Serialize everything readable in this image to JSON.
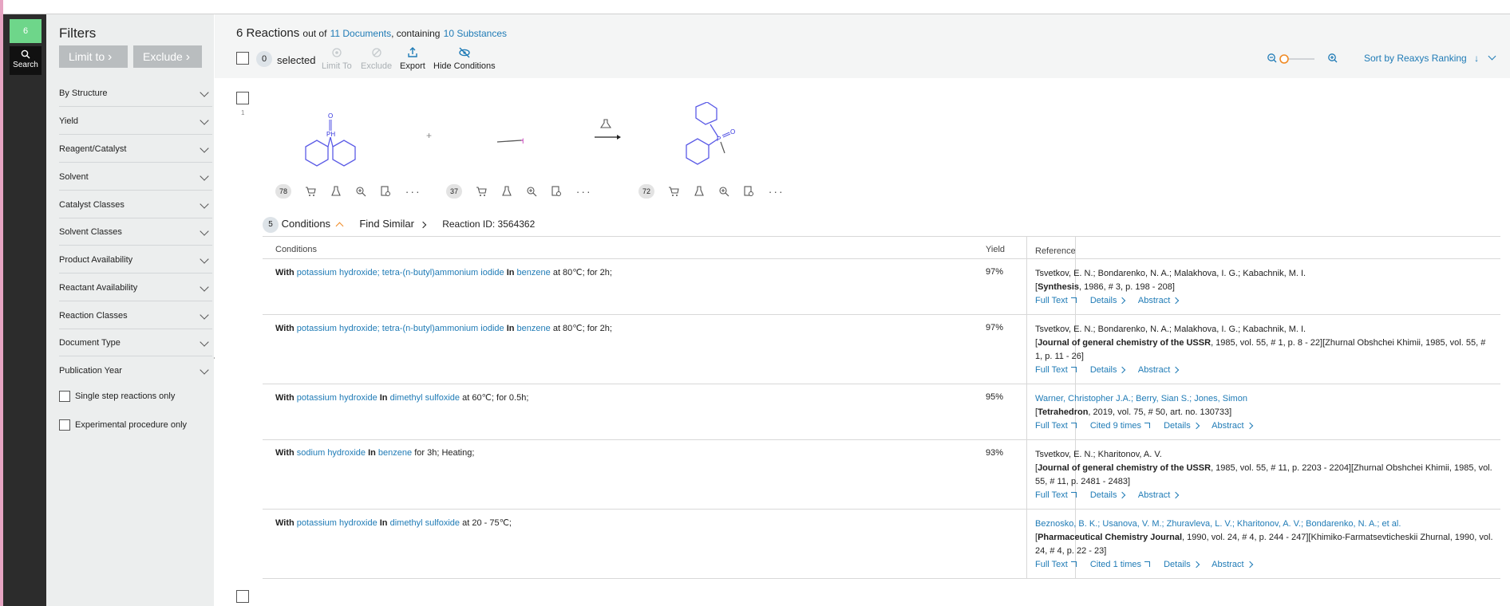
{
  "app": {
    "rail_badge": "6",
    "rail_search_label": "Search",
    "accent_color": "#1f7bb6",
    "badge_color": "#6ed68a"
  },
  "filters": {
    "title": "Filters",
    "limit_to": "Limit to",
    "exclude": "Exclude",
    "items": [
      "By Structure",
      "Yield",
      "Reagent/Catalyst",
      "Solvent",
      "Catalyst Classes",
      "Solvent Classes",
      "Product Availability",
      "Reactant Availability",
      "Reaction Classes",
      "Document Type",
      "Publication Year"
    ],
    "checkboxes": [
      "Single step reactions only",
      "Experimental procedure only"
    ]
  },
  "header": {
    "count": "6 Reactions",
    "out_of": "out of",
    "documents": "11 Documents",
    "containing": ", containing",
    "substances": "10 Substances",
    "selected_count": "0",
    "selected_label": "selected",
    "tools": {
      "limit_to": "Limit To",
      "exclude": "Exclude",
      "export": "Export",
      "hide_conditions": "Hide Conditions"
    },
    "sort_label": "Sort by Reaxys Ranking"
  },
  "reaction": {
    "number": "1",
    "plus": "+",
    "molecule_counts": [
      "78",
      "37",
      "72"
    ],
    "conditions_count": "5",
    "conditions_label": "Conditions",
    "find_similar": "Find Similar",
    "reaction_id": "Reaction ID: 3564362",
    "table_headers": {
      "conditions": "Conditions",
      "yield": "Yield",
      "reference": "Reference"
    },
    "rows": [
      {
        "with": "With",
        "reagents": "potassium hydroxide; tetra-(n-butyl)ammonium iodide",
        "in": "In",
        "solvent": "benzene",
        "tail": "at 80℃; for 2h;",
        "yield": "97%",
        "authors": "Tsvetkov, E. N.; Bondarenko, N. A.; Malakhova, I. G.; Kabachnik, M. I.",
        "citation_bold": "Synthesis",
        "citation_rest": ", 1986, # 3, p. 198 - 208]",
        "links": [
          "Full Text",
          "Details",
          "Abstract"
        ]
      },
      {
        "with": "With",
        "reagents": "potassium hydroxide; tetra-(n-butyl)ammonium iodide",
        "in": "In",
        "solvent": "benzene",
        "tail": "at 80℃; for 2h;",
        "yield": "97%",
        "authors": "Tsvetkov, E. N.; Bondarenko, N. A.; Malakhova, I. G.; Kabachnik, M. I.",
        "citation_bold": "Journal of general chemistry of the USSR",
        "citation_rest": ", 1985, vol. 55, # 1, p. 8 - 22][Zhurnal Obshchei Khimii, 1985, vol. 55, # 1, p. 11 - 26]",
        "links": [
          "Full Text",
          "Details",
          "Abstract"
        ]
      },
      {
        "with": "With",
        "reagents": "potassium hydroxide",
        "in": "In",
        "solvent": "dimethyl sulfoxide",
        "tail": "at 60℃; for 0.5h;",
        "yield": "95%",
        "authors": "Warner, Christopher J.A.; Berry, Sian S.; Jones, Simon",
        "citation_bold": "Tetrahedron",
        "citation_rest": ", 2019, vol. 75, # 50, art. no. 130733]",
        "links": [
          "Full Text",
          "Cited 9 times",
          "Details",
          "Abstract"
        ]
      },
      {
        "with": "With",
        "reagents": "sodium hydroxide",
        "in": "In",
        "solvent": "benzene",
        "tail": "for 3h; Heating;",
        "yield": "93%",
        "authors": "Tsvetkov, E. N.; Kharitonov, A. V.",
        "citation_bold": "Journal of general chemistry of the USSR",
        "citation_rest": ", 1985, vol. 55, # 11, p. 2203 - 2204][Zhurnal Obshchei Khimii, 1985, vol. 55, # 11, p. 2481 - 2483]",
        "links": [
          "Full Text",
          "Details",
          "Abstract"
        ]
      },
      {
        "with": "With",
        "reagents": "potassium hydroxide",
        "in": "In",
        "solvent": "dimethyl sulfoxide",
        "tail": "at 20 - 75℃;",
        "yield": "",
        "authors": "Beznosko, B. K.; Usanova, V. M.; Zhuravleva, L. V.; Kharitonov, A. V.; Bondarenko, N. A.; et al.",
        "citation_bold": "Pharmaceutical Chemistry Journal",
        "citation_rest": ", 1990, vol. 24, # 4, p. 244 - 247][Khimiko-Farmatsevticheskii Zhurnal, 1990, vol. 24, # 4, p. 22 - 23]",
        "links": [
          "Full Text",
          "Cited 1 times",
          "Details",
          "Abstract"
        ]
      }
    ]
  }
}
